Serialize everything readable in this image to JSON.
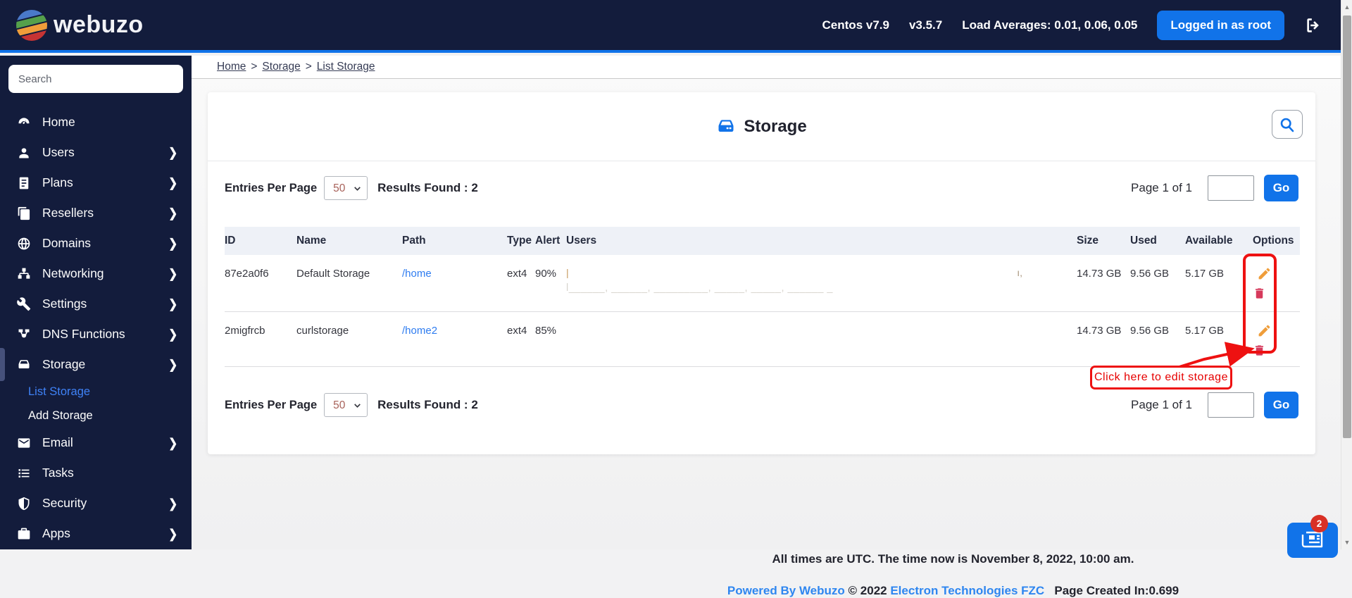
{
  "topbar": {
    "brand": "webuzo",
    "os": "Centos v7.9",
    "version": "v3.5.7",
    "load_averages": "Load Averages: 0.01, 0.06, 0.05",
    "login_button": "Logged in as root"
  },
  "sidebar": {
    "search_placeholder": "Search",
    "items": [
      {
        "label": "Home",
        "icon": "dashboard-icon",
        "chevron": false
      },
      {
        "label": "Users",
        "icon": "user-icon",
        "chevron": true
      },
      {
        "label": "Plans",
        "icon": "plans-icon",
        "chevron": true
      },
      {
        "label": "Resellers",
        "icon": "resellers-icon",
        "chevron": true
      },
      {
        "label": "Domains",
        "icon": "globe-icon",
        "chevron": true
      },
      {
        "label": "Networking",
        "icon": "network-icon",
        "chevron": true
      },
      {
        "label": "Settings",
        "icon": "wrench-icon",
        "chevron": true
      },
      {
        "label": "DNS Functions",
        "icon": "dns-icon",
        "chevron": true
      },
      {
        "label": "Storage",
        "icon": "storage-icon",
        "chevron": true,
        "active": true,
        "children": [
          {
            "label": "List Storage",
            "active": true
          },
          {
            "label": "Add Storage",
            "active": false
          }
        ]
      },
      {
        "label": "Email",
        "icon": "email-icon",
        "chevron": true
      },
      {
        "label": "Tasks",
        "icon": "tasks-icon",
        "chevron": false
      },
      {
        "label": "Security",
        "icon": "shield-icon",
        "chevron": true
      },
      {
        "label": "Apps",
        "icon": "apps-icon",
        "chevron": true
      }
    ]
  },
  "breadcrumb": [
    "Home",
    "Storage",
    "List Storage"
  ],
  "page": {
    "title": "Storage",
    "entries_per_page_label": "Entries Per Page",
    "entries_per_page_value": "50",
    "results_found": "Results Found : 2",
    "page_label": "Page 1 of 1",
    "page_input_value": "",
    "go_label": "Go"
  },
  "table": {
    "columns": [
      "ID",
      "Name",
      "Path",
      "Type",
      "Alert",
      "Users",
      "Size",
      "Used",
      "Available",
      "Options"
    ],
    "rows": [
      {
        "id": "87e2a0f6",
        "name": "Default Storage",
        "path": "/home",
        "type": "ext4",
        "alert": "90%",
        "users_redacted": true,
        "users_ghost": {
          "line1_start": "|",
          "line1_end": "ı,",
          "line2": "l______, ______, _________, _____, _____, ______ _"
        },
        "size": "14.73 GB",
        "used": "9.56 GB",
        "available": "5.17 GB"
      },
      {
        "id": "2migfrcb",
        "name": "curlstorage",
        "path": "/home2",
        "type": "ext4",
        "alert": "85%",
        "users_redacted": false,
        "users_ghost": null,
        "size": "14.73 GB",
        "used": "9.56 GB",
        "available": "5.17 GB"
      }
    ]
  },
  "annotation": {
    "label": "Click here to edit storage"
  },
  "footer": {
    "time_note": "All times are UTC. The time now is November 8, 2022, 10:00 am.",
    "powered_by": "Powered By Webuzo",
    "copyright": "© 2022",
    "company": "Electron Technologies FZC",
    "page_created": "Page Created In:0.699",
    "chat_badge": "2"
  },
  "colors": {
    "navy": "#131c3c",
    "accent_blue": "#1173e9",
    "link_blue": "#2e7cf0",
    "active_subitem": "#3f82f7",
    "table_header_bg": "#eef1f7",
    "edit_orange": "#ef9d3a",
    "delete_red": "#d6395b",
    "annotation_red": "#ee1111",
    "badge_red": "#d93025"
  }
}
